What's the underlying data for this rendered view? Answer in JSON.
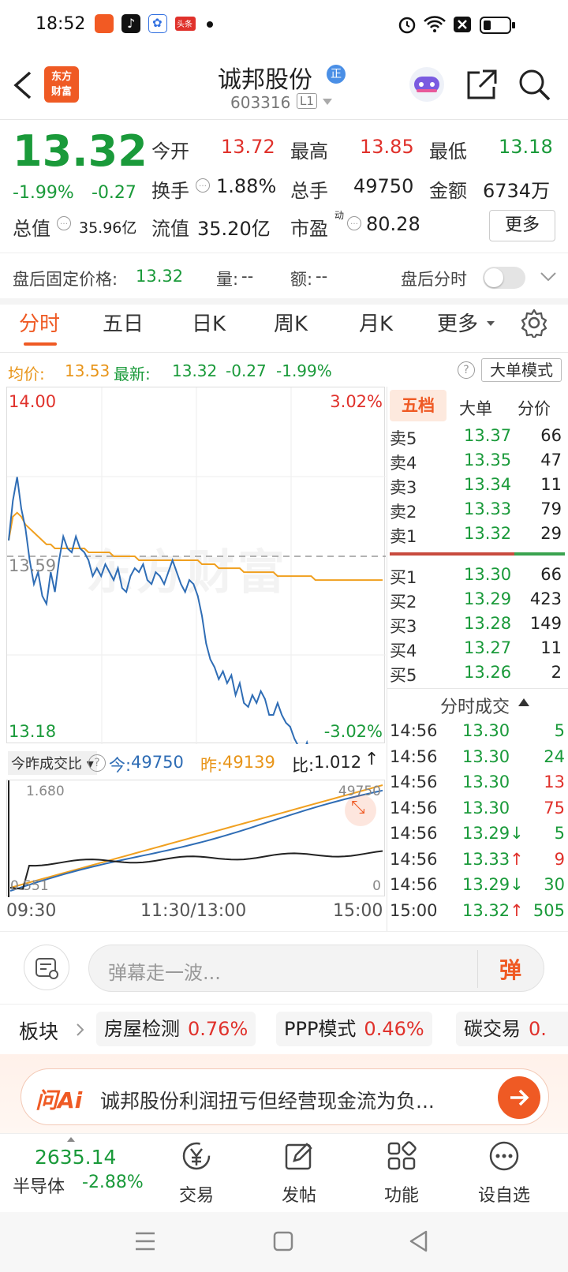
{
  "status_bar": {
    "time": "18:52",
    "notification_apps": [
      "orange-app-icon",
      "tiktok-icon",
      "baidu-icon",
      "toutiao-icon"
    ],
    "toutiao_label": "头条"
  },
  "header": {
    "logo_text_1": "东方",
    "logo_text_2": "财富",
    "stock_name": "诚邦股份",
    "badge": "正",
    "stock_code": "603316",
    "level": "L1"
  },
  "quote": {
    "price": "13.32",
    "change_pct": "-1.99%",
    "change": "-0.27",
    "open_label": "今开",
    "open": "13.72",
    "high_label": "最高",
    "high": "13.85",
    "low_label": "最低",
    "low": "13.18",
    "turnover_label": "换手",
    "turnover": "1.88%",
    "volume_label": "总手",
    "volume": "49750",
    "amount_label": "金额",
    "amount": "6734万",
    "mktcap_label": "总值",
    "mktcap": "35.96亿",
    "float_label": "流值",
    "float_cap": "35.20亿",
    "pe_label": "市盈",
    "pe_sup": "动",
    "pe": "80.28",
    "more_button": "更多"
  },
  "after_hours": {
    "fixed_label": "盘后固定价格:",
    "fixed_price": "13.32",
    "vol_label": "量:",
    "vol": "--",
    "amt_label": "额:",
    "amt": "--",
    "timeshare_label": "盘后分时"
  },
  "tabs": [
    "分时",
    "五日",
    "日K",
    "周K",
    "月K",
    "更多"
  ],
  "info_bar": {
    "avg_label": "均价:",
    "avg": "13.53",
    "latest_label": "最新:",
    "latest": "13.32",
    "chg": "-0.27",
    "chg_pct": "-1.99%",
    "big_order_mode": "大单模式"
  },
  "chart_labels": {
    "top_price": "14.00",
    "top_pct": "3.02%",
    "mid_price": "13.59",
    "bottom_price": "13.18",
    "bottom_pct": "-3.02%"
  },
  "volume_bar": {
    "selector": "今昨成交比",
    "today_label": "今:",
    "today": "49750",
    "yesterday_label": "昨:",
    "yesterday": "49139",
    "ratio_label": "比:",
    "ratio": "1.012",
    "vmax": "1.680",
    "vmin": "0.551",
    "rmax": "49750",
    "rmin": "0"
  },
  "time_axis": [
    "09:30",
    "11:30/13:00",
    "15:00"
  ],
  "order_book": {
    "tabs": [
      "五档",
      "大单",
      "分价"
    ],
    "asks": [
      {
        "label": "卖5",
        "price": "13.37",
        "vol": "66"
      },
      {
        "label": "卖4",
        "price": "13.35",
        "vol": "47"
      },
      {
        "label": "卖3",
        "price": "13.34",
        "vol": "11"
      },
      {
        "label": "卖2",
        "price": "13.33",
        "vol": "79"
      },
      {
        "label": "卖1",
        "price": "13.32",
        "vol": "29"
      }
    ],
    "bids": [
      {
        "label": "买1",
        "price": "13.30",
        "vol": "66"
      },
      {
        "label": "买2",
        "price": "13.29",
        "vol": "423"
      },
      {
        "label": "买3",
        "price": "13.28",
        "vol": "149"
      },
      {
        "label": "买4",
        "price": "13.27",
        "vol": "11"
      },
      {
        "label": "买5",
        "price": "13.26",
        "vol": "2"
      }
    ]
  },
  "ticks": {
    "title": "分时成交",
    "rows": [
      {
        "time": "14:56",
        "price": "13.30",
        "arrow": "",
        "vol": "5",
        "color": "#1a9a3a"
      },
      {
        "time": "14:56",
        "price": "13.30",
        "arrow": "",
        "vol": "24",
        "color": "#1a9a3a"
      },
      {
        "time": "14:56",
        "price": "13.30",
        "arrow": "",
        "vol": "13",
        "color": "#e0312b"
      },
      {
        "time": "14:56",
        "price": "13.30",
        "arrow": "",
        "vol": "75",
        "color": "#e0312b"
      },
      {
        "time": "14:56",
        "price": "13.29",
        "arrow": "↓",
        "vol": "5",
        "color": "#1a9a3a"
      },
      {
        "time": "14:56",
        "price": "13.33",
        "arrow": "↑",
        "vol": "9",
        "color": "#e0312b"
      },
      {
        "time": "14:56",
        "price": "13.29",
        "arrow": "↓",
        "vol": "30",
        "color": "#1a9a3a"
      },
      {
        "time": "15:00",
        "price": "13.32",
        "arrow": "↑",
        "vol": "505",
        "color": "#1a9a3a"
      }
    ]
  },
  "danmu": {
    "placeholder": "弹幕走一波...",
    "send": "弹"
  },
  "sectors": {
    "label": "板块",
    "items": [
      {
        "name": "房屋检测",
        "pct": "0.76%"
      },
      {
        "name": "PPP模式",
        "pct": "0.46%"
      },
      {
        "name": "碳交易",
        "pct": "0."
      }
    ]
  },
  "ai": {
    "logo": "问Ai",
    "text": "诚邦股份利润扭亏但经营现金流为负..."
  },
  "bottom_nav": {
    "index_value": "2635.14",
    "index_name": "半导体",
    "index_pct": "-2.88%",
    "items": [
      "交易",
      "发帖",
      "功能",
      "设自选"
    ]
  },
  "watermark": "东方财富",
  "chart_data": {
    "type": "line",
    "title": "",
    "xlabel": "",
    "ylabel": "",
    "x_ticks": [
      "09:30",
      "11:30/13:00",
      "15:00"
    ],
    "ylim": [
      13.18,
      14.0
    ],
    "reference_price": 13.59,
    "series": [
      {
        "name": "最新",
        "color": "#2f6db5",
        "values": [
          13.63,
          13.73,
          13.79,
          13.71,
          13.66,
          13.58,
          13.52,
          13.55,
          13.49,
          13.47,
          13.55,
          13.5,
          13.58,
          13.64,
          13.61,
          13.6,
          13.64,
          13.61,
          13.6,
          13.58,
          13.54,
          13.56,
          13.54,
          13.57,
          13.55,
          13.53,
          13.56,
          13.51,
          13.5,
          13.54,
          13.56,
          13.55,
          13.57,
          13.53,
          13.52,
          13.55,
          13.54,
          13.52,
          13.55,
          13.58,
          13.55,
          13.52,
          13.5,
          13.53,
          13.52,
          13.49,
          13.44,
          13.37,
          13.33,
          13.31,
          13.28,
          13.3,
          13.27,
          13.29,
          13.24,
          13.27,
          13.22,
          13.21,
          13.24,
          13.22,
          13.25,
          13.23,
          13.19,
          13.19,
          13.22,
          13.19,
          13.17,
          13.16,
          13.13,
          13.11,
          13.09,
          13.12,
          13.08,
          13.1,
          13.06,
          13.04,
          13.07,
          13.03,
          13.0,
          13.02,
          12.98,
          12.97,
          12.99,
          12.96,
          12.93,
          12.95,
          12.92,
          12.96,
          12.99,
          13.04
        ]
      },
      {
        "name": "均价",
        "color": "#f0a020",
        "values": [
          13.63,
          13.69,
          13.7,
          13.69,
          13.67,
          13.66,
          13.65,
          13.64,
          13.63,
          13.62,
          13.62,
          13.61,
          13.61,
          13.61,
          13.61,
          13.61,
          13.61,
          13.61,
          13.61,
          13.6,
          13.6,
          13.6,
          13.6,
          13.6,
          13.6,
          13.59,
          13.59,
          13.59,
          13.59,
          13.59,
          13.59,
          13.58,
          13.58,
          13.58,
          13.58,
          13.58,
          13.58,
          13.58,
          13.58,
          13.58,
          13.58,
          13.58,
          13.58,
          13.58,
          13.58,
          13.58,
          13.57,
          13.57,
          13.57,
          13.57,
          13.56,
          13.56,
          13.56,
          13.56,
          13.56,
          13.56,
          13.55,
          13.55,
          13.55,
          13.55,
          13.55,
          13.55,
          13.55,
          13.55,
          13.54,
          13.54,
          13.54,
          13.54,
          13.54,
          13.54,
          13.54,
          13.54,
          13.54,
          13.53,
          13.53,
          13.53,
          13.53,
          13.53,
          13.53,
          13.53,
          13.53,
          13.53,
          13.53,
          13.53,
          13.53,
          13.53,
          13.53,
          13.53,
          13.53,
          13.53
        ]
      }
    ]
  }
}
